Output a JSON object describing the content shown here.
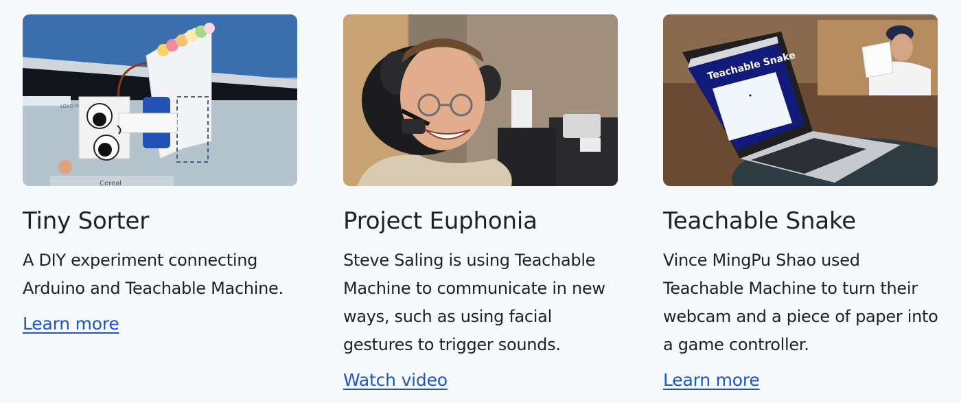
{
  "cards": [
    {
      "title": "Tiny Sorter",
      "description": "A DIY experiment connecting Arduino and Teachable Machine.",
      "link_label": "Learn more",
      "image_text": {
        "button": "LOAD MODEL",
        "label": "Cereal"
      }
    },
    {
      "title": "Project Euphonia",
      "description": "Steve Saling is using Teachable Machine to communicate in new ways, such as using facial gestures to trigger sounds.",
      "link_label": "Watch video"
    },
    {
      "title": "Teachable Snake",
      "description": "Vince MingPu Shao used Teachable Machine to turn their webcam and a piece of paper into a game controller.",
      "link_label": "Learn more",
      "image_text": {
        "screen_title": "Teachable Snake"
      }
    }
  ],
  "colors": {
    "link": "#1a57c8",
    "background": "#f8f9fb",
    "text": "#202124"
  }
}
